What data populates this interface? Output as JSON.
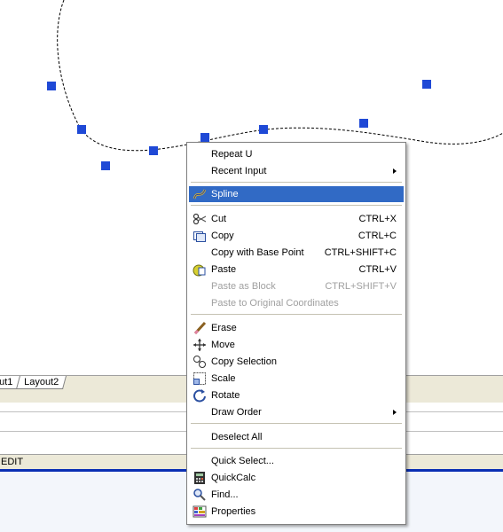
{
  "tabs": {
    "tab1": "ut1",
    "tab2": "Layout2"
  },
  "status": {
    "text": "EDIT"
  },
  "menu": {
    "repeat": {
      "label": "Repeat U"
    },
    "recent_input": {
      "label": "Recent Input"
    },
    "spline": {
      "label": "Spline"
    },
    "cut": {
      "label": "Cut",
      "shortcut": "CTRL+X"
    },
    "copy": {
      "label": "Copy",
      "shortcut": "CTRL+C"
    },
    "copy_base": {
      "label": "Copy with Base Point",
      "shortcut": "CTRL+SHIFT+C"
    },
    "paste": {
      "label": "Paste",
      "shortcut": "CTRL+V"
    },
    "paste_block": {
      "label": "Paste as Block",
      "shortcut": "CTRL+SHIFT+V"
    },
    "paste_orig": {
      "label": "Paste to Original Coordinates"
    },
    "erase": {
      "label": "Erase"
    },
    "move": {
      "label": "Move"
    },
    "copy_selection": {
      "label": "Copy Selection"
    },
    "scale": {
      "label": "Scale"
    },
    "rotate": {
      "label": "Rotate"
    },
    "draw_order": {
      "label": "Draw Order"
    },
    "deselect_all": {
      "label": "Deselect All"
    },
    "quick_select": {
      "label": "Quick Select..."
    },
    "quickcalc": {
      "label": "QuickCalc"
    },
    "find": {
      "label": "Find..."
    },
    "properties": {
      "label": "Properties"
    }
  },
  "icons": {
    "spline": "spline-icon",
    "cut": "scissors-icon",
    "copy": "copy-icon",
    "paste": "paste-icon",
    "erase": "eraser-icon",
    "move": "move-icon",
    "copy_selection": "copy-selection-icon",
    "scale": "scale-icon",
    "rotate": "rotate-icon",
    "quickcalc": "calculator-icon",
    "find": "find-icon",
    "properties": "properties-icon"
  },
  "colors": {
    "grip": "#1f49d6",
    "highlight": "#316ac5",
    "status_blue": "#0a2fb4"
  }
}
